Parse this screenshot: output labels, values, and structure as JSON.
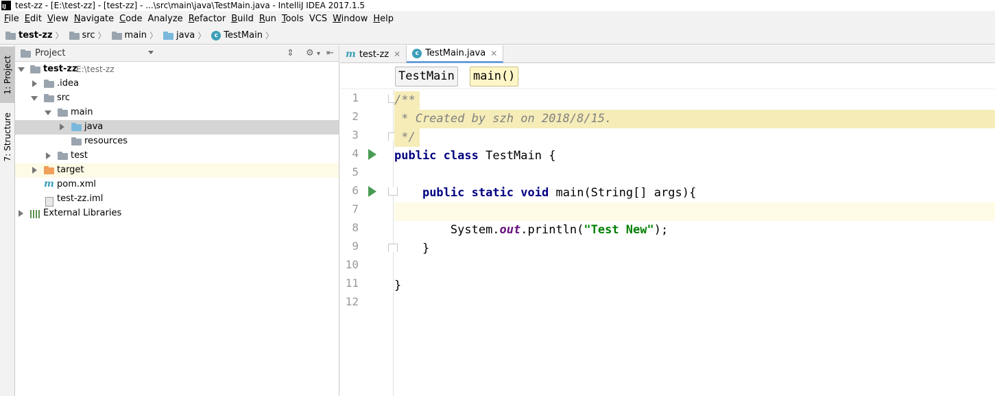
{
  "window": {
    "title": "test-zz - [E:\\test-zz] - [test-zz] - ...\\src\\main\\java\\TestMain.java - IntelliJ IDEA 2017.1.5",
    "app_icon_text": "IJ"
  },
  "menu": {
    "items": [
      {
        "mnemonic": "F",
        "rest": "ile"
      },
      {
        "mnemonic": "E",
        "rest": "dit"
      },
      {
        "mnemonic": "V",
        "rest": "iew"
      },
      {
        "mnemonic": "N",
        "rest": "avigate"
      },
      {
        "mnemonic": "C",
        "rest": "ode"
      },
      {
        "mnemonic": "",
        "rest": "Analyze"
      },
      {
        "mnemonic": "R",
        "rest": "efactor"
      },
      {
        "mnemonic": "B",
        "rest": "uild"
      },
      {
        "mnemonic": "R",
        "rest": "un"
      },
      {
        "mnemonic": "T",
        "rest": "ools"
      },
      {
        "mnemonic": "",
        "rest": "VCS"
      },
      {
        "mnemonic": "W",
        "rest": "indow"
      },
      {
        "mnemonic": "H",
        "rest": "elp"
      }
    ]
  },
  "breadcrumb": {
    "items": [
      "test-zz",
      "src",
      "main",
      "java",
      "TestMain"
    ]
  },
  "tool_stripe": {
    "project_tab": "1: Project",
    "structure_tab": "7: Structure"
  },
  "project_panel": {
    "header": "Project",
    "tree": {
      "root_name": "test-zz",
      "root_path": "E:\\test-zz",
      "idea": ".idea",
      "src": "src",
      "main": "main",
      "java": "java",
      "resources": "resources",
      "test": "test",
      "target": "target",
      "pom": "pom.xml",
      "iml": "test-zz.iml",
      "external_libraries": "External Libraries"
    }
  },
  "editor": {
    "tabs": [
      {
        "label": "test-zz",
        "close": "✕"
      },
      {
        "label": "TestMain.java",
        "close": "✕"
      }
    ],
    "code_crumbs": {
      "class_name": "TestMain",
      "method_name": "main()"
    },
    "line_numbers": [
      "1",
      "2",
      "3",
      "4",
      "5",
      "6",
      "7",
      "8",
      "9",
      "10",
      "11",
      "12"
    ],
    "code": {
      "l1": "/**",
      "l2": " * Created by szh on 2018/8/15.",
      "l3": " */",
      "l4_kw1": "public",
      "l4_kw2": "class",
      "l4_rest": "TestMain {",
      "l6_kw1": "public",
      "l6_kw2": "static",
      "l6_kw3": "void",
      "l6_rest": "main(String[] args){",
      "l8_a": "System.",
      "l8_field": "out",
      "l8_b": ".println(",
      "l8_str": "\"Test New\"",
      "l8_c": ");",
      "l9": "}",
      "l11": "}"
    },
    "colors": {
      "keyword": "#000080",
      "comment": "#808080",
      "string": "#008000",
      "field": "#660e7a",
      "run_gutter": "#499c54",
      "doc_comment_bg": "#f5ecb8"
    }
  }
}
